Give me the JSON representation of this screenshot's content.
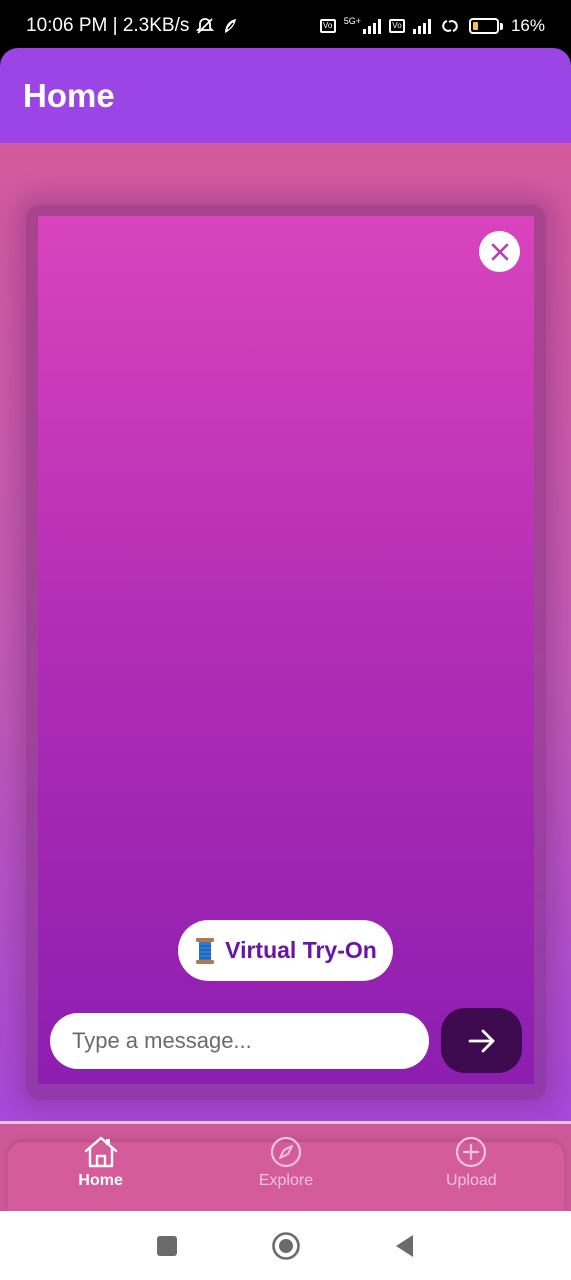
{
  "status_bar": {
    "time": "10:06 PM | 2.3KB/s",
    "network": "5G+",
    "battery": "16%"
  },
  "header": {
    "title": "Home"
  },
  "card": {
    "tryon_label": "Virtual Try-On",
    "message_placeholder": "Type a message..."
  },
  "bottom_nav": {
    "items": [
      {
        "label": "Home",
        "icon": "home-icon",
        "active": true
      },
      {
        "label": "Explore",
        "icon": "compass-icon",
        "active": false
      },
      {
        "label": "Upload",
        "icon": "plus-circle-icon",
        "active": false
      }
    ]
  },
  "colors": {
    "header": "#9b45e6",
    "card_top": "#d944bd",
    "card_bottom": "#8c1eb0",
    "send_button": "#3e0a4f",
    "nav_background": "#d45c9a",
    "tryon_text": "#6a13a6"
  }
}
